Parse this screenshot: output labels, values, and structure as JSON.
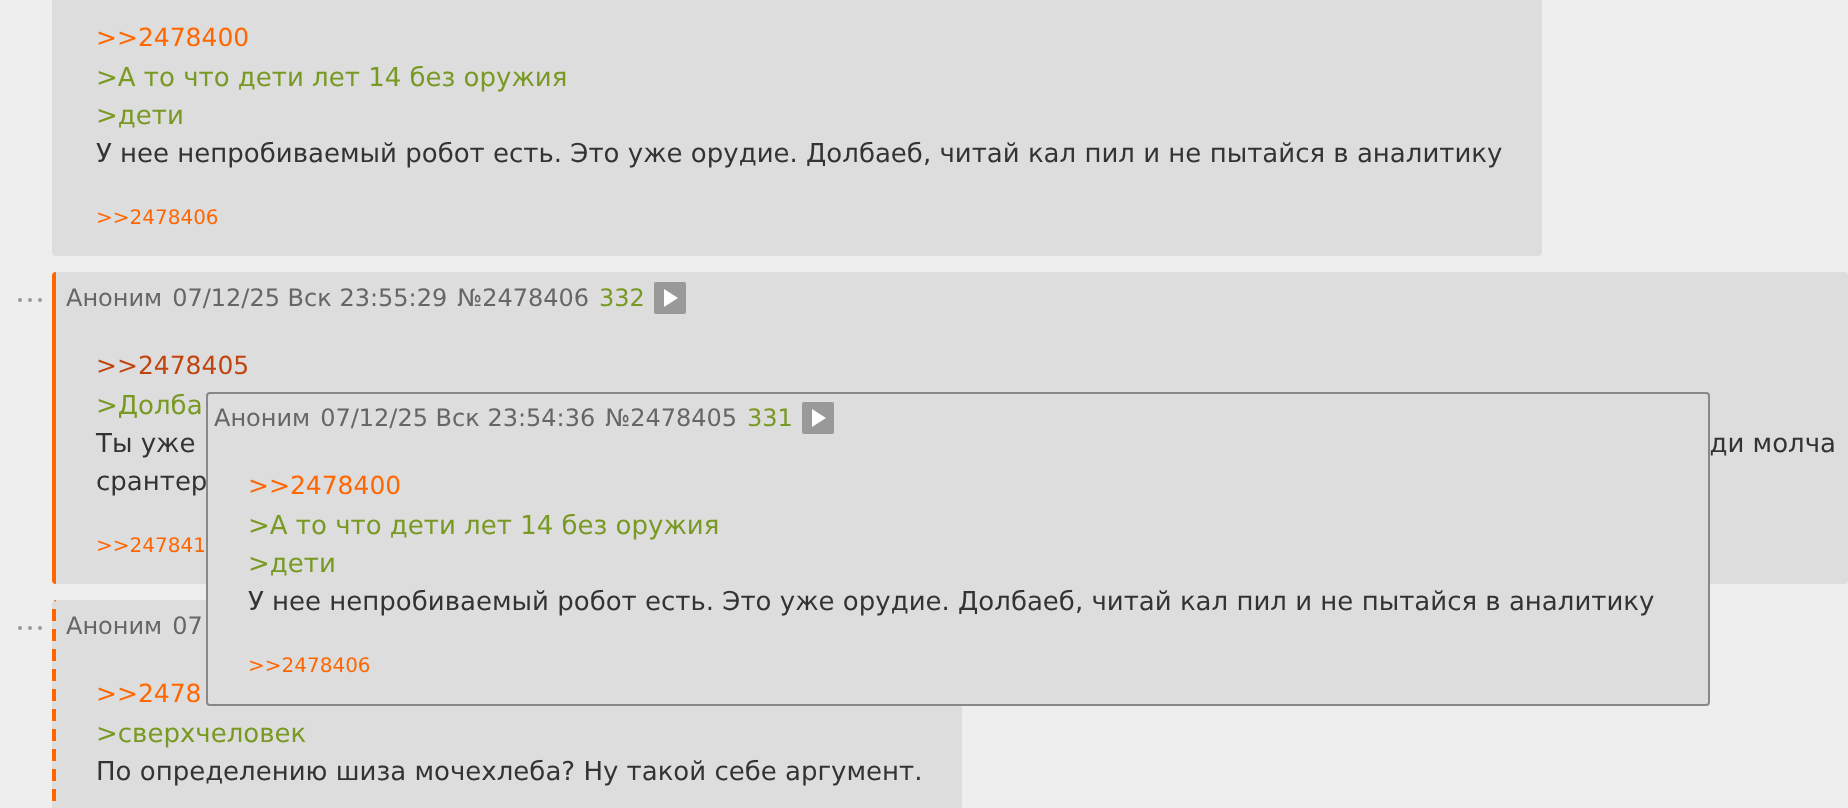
{
  "posts": [
    {
      "kind": "plain",
      "lines": [
        {
          "kind": "reply",
          "visited": false,
          "text": ">>2478400"
        },
        {
          "kind": "quote",
          "text": ">А то что дети лет 14 без оружия"
        },
        {
          "kind": "quote",
          "text": ">дети"
        },
        {
          "kind": "text",
          "text": "У нее непробиваемый робот есть. Это уже орудие. Долбаеб, читай кал пил и не пытайся в аналитику"
        }
      ],
      "backlinks": [
        ">>2478406"
      ]
    },
    {
      "kind": "marked",
      "header": {
        "author": "Аноним",
        "date": "07/12/25 Вск 23:55:29",
        "number": "№2478406",
        "count": "332"
      },
      "lines": [
        {
          "kind": "reply",
          "visited": true,
          "text": ">>2478405"
        },
        {
          "kind": "quote",
          "text": ">Долба"
        },
        {
          "kind": "split",
          "parts": [
            "Ты уже",
            "ди молча"
          ]
        },
        {
          "kind": "text",
          "text": "срантер"
        }
      ],
      "backlinks": [
        ">>247841"
      ]
    },
    {
      "kind": "marked_dashed",
      "header": {
        "author": "Аноним",
        "date": "07"
      },
      "lines": [
        {
          "kind": "reply",
          "visited": false,
          "text": ">>2478"
        },
        {
          "kind": "quote",
          "text": ">сверхчеловек"
        },
        {
          "kind": "text",
          "text": "По определению шиза мочехлеба? Ну такой себе аргумент."
        }
      ]
    }
  ],
  "popup": {
    "header": {
      "author": "Аноним",
      "date": "07/12/25 Вск 23:54:36",
      "number": "№2478405",
      "count": "331"
    },
    "lines": [
      {
        "kind": "reply",
        "visited": false,
        "text": ">>2478400"
      },
      {
        "kind": "quote",
        "text": ">А то что дети лет 14 без оружия"
      },
      {
        "kind": "quote",
        "text": ">дети"
      },
      {
        "kind": "text",
        "text": "У нее непробиваемый робот есть. Это уже орудие. Долбаеб, читай кал пил и не пытайся в аналитику"
      }
    ],
    "backlinks": [
      ">>2478406"
    ]
  }
}
